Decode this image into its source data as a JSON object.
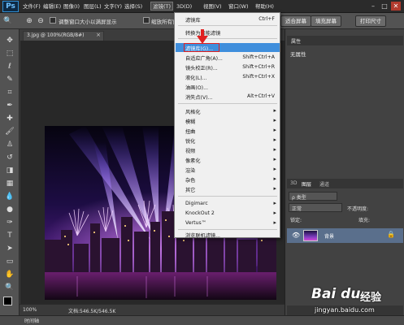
{
  "app": {
    "logo": "Ps"
  },
  "menubar": {
    "items": [
      "文件(F)",
      "编辑(E)",
      "图像(I)",
      "图层(L)",
      "文字(Y)",
      "选择(S)",
      "滤镜(T)",
      "3D(D)",
      "视图(V)",
      "窗口(W)",
      "帮助(H)"
    ],
    "active_index": 6
  },
  "window_controls": {
    "minimize": "–",
    "maximize": "□",
    "close": "✕"
  },
  "options_bar": {
    "checkbox_fit_window": "调整窗口大小以满屏显示",
    "checkbox_zoom_all": "缩放所有窗口",
    "buttons": [
      "填充屏幕",
      "打印尺寸"
    ],
    "partial_button": "适合屏幕"
  },
  "document": {
    "tab_title": "3.jpg @ 100%(RGB/8#)",
    "close": "×",
    "zoom": "100%",
    "info": "文档:546.5K/546.5K"
  },
  "timeline": {
    "label": "时间轴"
  },
  "properties": {
    "title": "属性",
    "value": "无属性"
  },
  "layers": {
    "tabs": [
      "3D",
      "图层",
      "通道"
    ],
    "active_tab": "图层",
    "kind_filter": "ρ 类型",
    "blend_mode": "正常",
    "opacity_label": "不透明度:",
    "lock_label": "锁定:",
    "fill_label": "填充:",
    "layer_name": "背景"
  },
  "filter_menu": {
    "top_items": [
      {
        "label": "滤镜库",
        "shortcut": "Ctrl+F"
      },
      {
        "label": "转换为智能滤镜",
        "shortcut": ""
      }
    ],
    "main_items": [
      {
        "label": "滤镜库(G)...",
        "shortcut": "",
        "highlight": true
      },
      {
        "label": "自适应广角(A)...",
        "shortcut": "Shift+Ctrl+A"
      },
      {
        "label": "镜头校正(R)...",
        "shortcut": "Shift+Ctrl+R"
      },
      {
        "label": "液化(L)...",
        "shortcut": "Shift+Ctrl+X"
      },
      {
        "label": "油画(O)...",
        "shortcut": ""
      },
      {
        "label": "消失点(V)...",
        "shortcut": "Alt+Ctrl+V"
      }
    ],
    "submenu_items": [
      "风格化",
      "模糊",
      "扭曲",
      "锐化",
      "视频",
      "像素化",
      "渲染",
      "杂色",
      "其它"
    ],
    "plugin_items": [
      "Digimarc",
      "KnockOut 2",
      "Vertus™"
    ],
    "bottom_items": [
      "浏览联机滤镜..."
    ]
  },
  "watermark": {
    "brand": "Bai du",
    "product": "经验",
    "url": "jingyan.baidu.com"
  },
  "colors": {
    "menu_highlight": "#3f8edc",
    "panel_bg": "#424242",
    "outline_red": "#e02020"
  }
}
